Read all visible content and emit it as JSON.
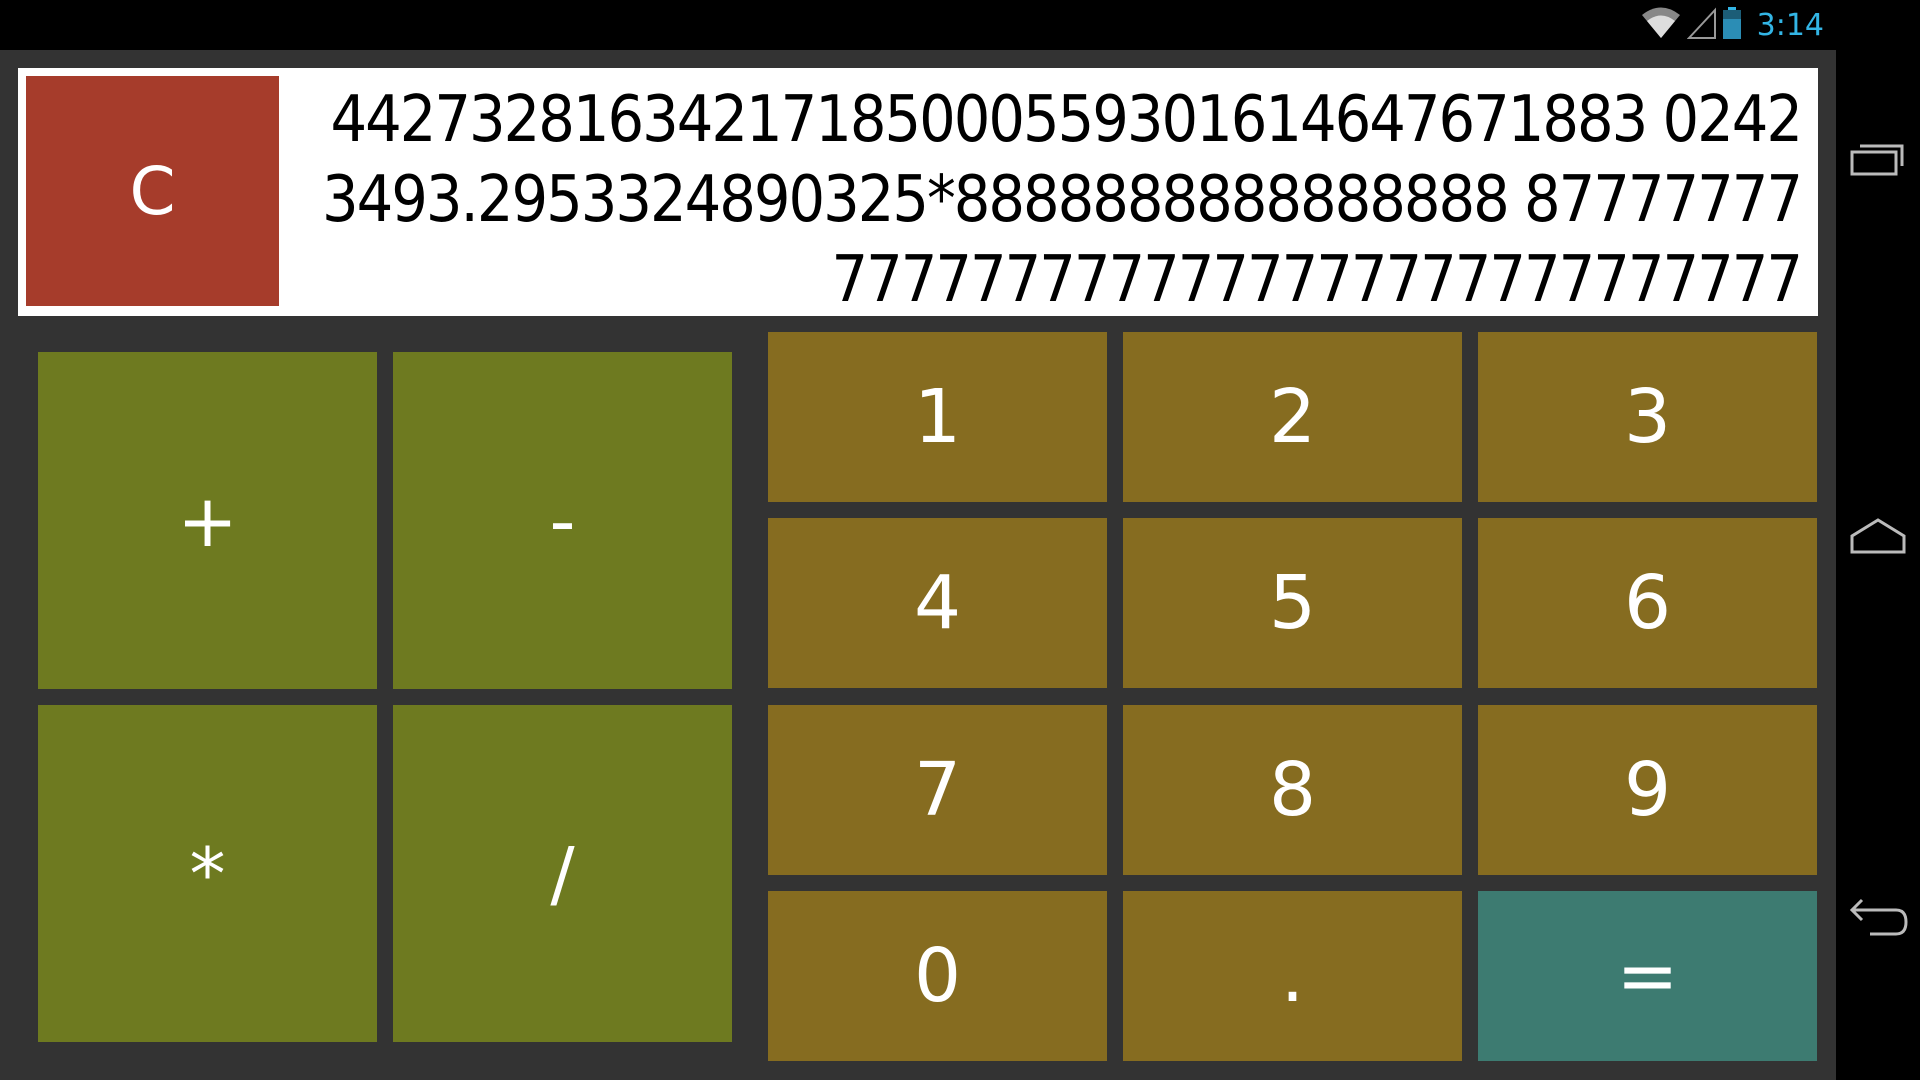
{
  "status_bar": {
    "time": "3:14",
    "icons": [
      "wifi-icon",
      "signal-icon",
      "battery-icon"
    ]
  },
  "nav_bar": {
    "buttons": [
      "recent-apps-icon",
      "home-icon",
      "back-icon"
    ]
  },
  "display": {
    "clear_label": "C",
    "expression": "44273281634217185000559301614647671883 02423493.2953324890325*8888888888888888 877777777777777777777777777777777777"
  },
  "operators": {
    "plus": "+",
    "minus": "-",
    "multiply": "*",
    "divide": "/"
  },
  "keypad": {
    "k1": "1",
    "k2": "2",
    "k3": "3",
    "k4": "4",
    "k5": "5",
    "k6": "6",
    "k7": "7",
    "k8": "8",
    "k9": "9",
    "k0": "0",
    "dot": ".",
    "equals": "="
  },
  "colors": {
    "clear": "#a63c2b",
    "operator": "#6e7a20",
    "number": "#866c20",
    "equals": "#3d7b71",
    "background": "#333333",
    "time": "#33b5e5"
  }
}
